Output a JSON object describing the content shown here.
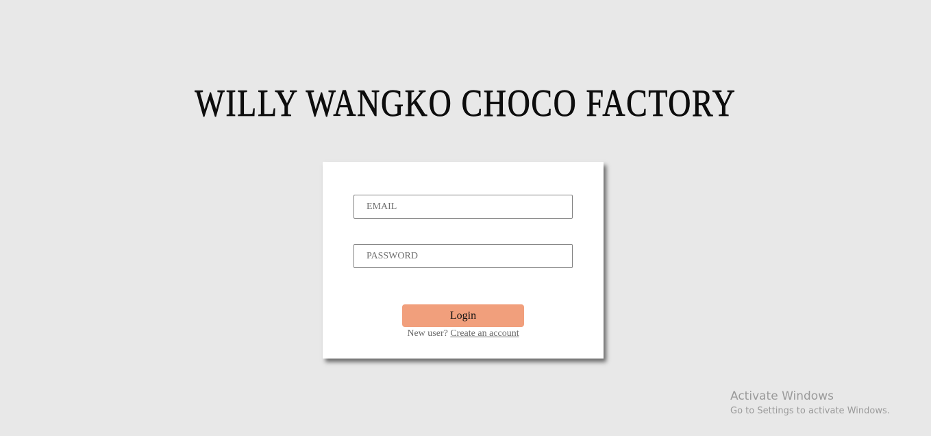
{
  "header": {
    "title": "WILLY WANGKO CHOCO FACTORY"
  },
  "login_form": {
    "email_placeholder": "EMAIL",
    "password_placeholder": "PASSWORD",
    "login_label": "Login",
    "new_user_text": "New user?",
    "create_account_label": "Create an account"
  },
  "os_watermark": {
    "title": "Activate Windows",
    "subtitle": "Go to Settings to activate Windows."
  },
  "colors": {
    "page_background": "#e8e8e8",
    "card_background": "#ffffff",
    "login_button": "#f19f7c"
  }
}
